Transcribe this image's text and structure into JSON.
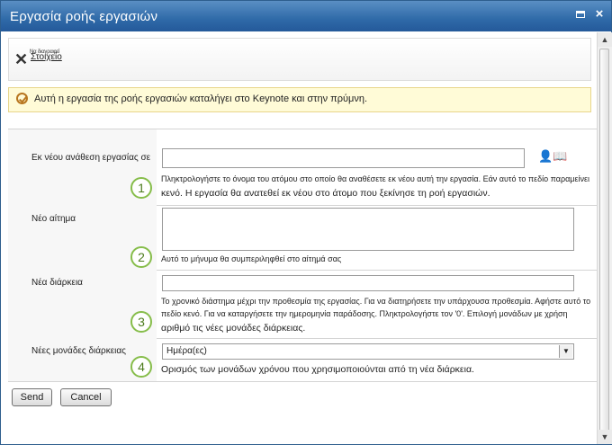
{
  "window": {
    "title": "Εργασία ροής εργασιών",
    "maximize_icon": "maximize-icon",
    "close_icon": "close-icon",
    "close_glyph": "×"
  },
  "ribbon": {
    "cancel_small_text": "Να διαγραφεί",
    "item_label": "Στοιχείο"
  },
  "notice": {
    "text": "Αυτή η εργασία της ροής εργασιών καταλήγει στο Keynote και στην πρύμνη.",
    "background": "#fffbd7"
  },
  "form": {
    "reassign": {
      "label": "Εκ νέου ανάθεση εργασίας σε",
      "value": "",
      "help_line1": "Πληκτρολογήστε το όνομα του ατόμου στο οποίο θα αναθέσετε εκ νέου αυτή την εργασία. Εάν αυτό το πεδίο παραμείνει",
      "help_line2": "κενό. Η εργασία θα ανατεθεί εκ νέου στο άτομο που ξεκίνησε τη ροή εργασιών.",
      "badge": "1"
    },
    "request": {
      "label": "Νέο αίτημα",
      "value": "",
      "help": "Αυτό το μήνυμα θα συμπεριληφθεί στο αίτημά σας",
      "badge": "2"
    },
    "duration": {
      "label": "Νέα διάρκεια",
      "value": "",
      "help_line1": "Το χρονικό διάστημα μέχρι την προθεσμία της εργασίας. Για να διατηρήσετε την υπάρχουσα προθεσμία. Αφήστε αυτό το",
      "help_line2": "πεδίο κενό. Για να καταργήσετε την ημερομηνία παράδοσης. Πληκτρολογήστε τον '0'. Επιλογή μονάδων με χρήση",
      "help_line3": "αριθμό τις νέες μονάδες διάρκειας.",
      "badge": "3"
    },
    "duration_units": {
      "label": "Νέες μονάδες διάρκειας",
      "selected": "Ημέρα(ες)",
      "help": "Ορισμός των μονάδων χρόνου που χρησιμοποιούνται από τη νέα διάρκεια.",
      "badge": "4"
    }
  },
  "buttons": {
    "send": "Send",
    "cancel": "Cancel"
  }
}
